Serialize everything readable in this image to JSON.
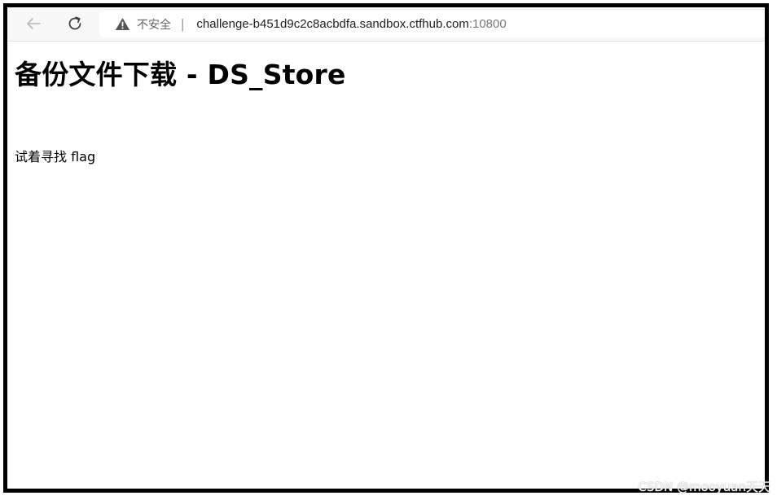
{
  "browser": {
    "security_label": "不安全",
    "separator": "|",
    "url_host": "challenge-b451d9c2c8acbdfa.sandbox.ctfhub.com",
    "url_port": ":10800",
    "icons": {
      "back": "arrow-left-icon",
      "reload": "reload-icon",
      "warning": "warning-triangle-icon"
    }
  },
  "page": {
    "title": "备份文件下载 - DS_Store",
    "text": "试着寻找 flag"
  },
  "watermark": "CSDN @mooyuan天天"
}
